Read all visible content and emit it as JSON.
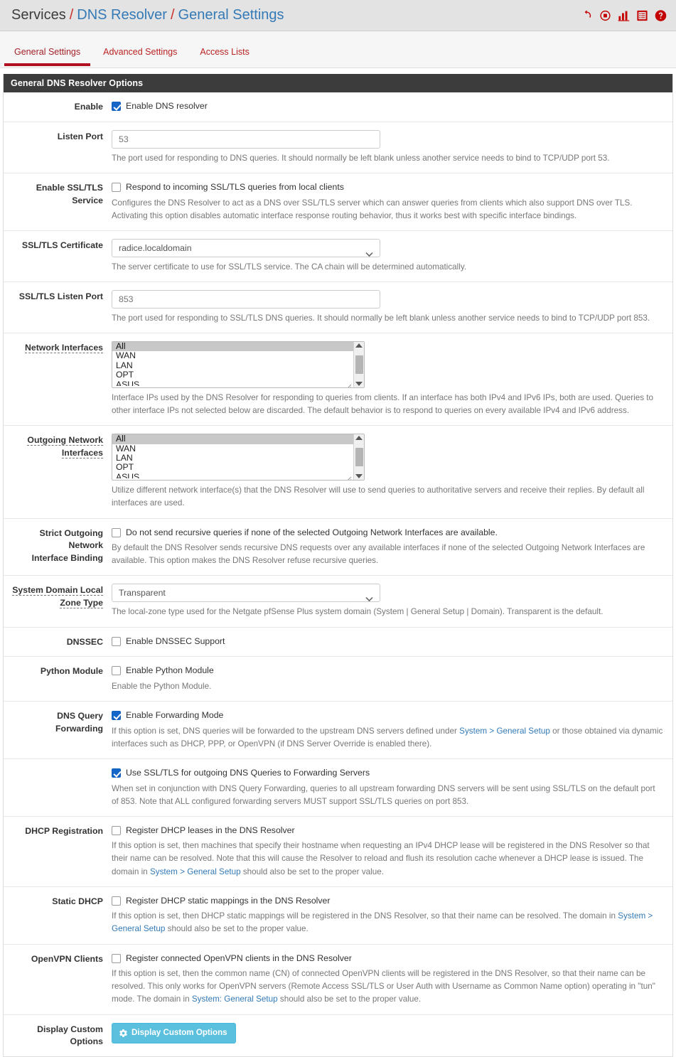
{
  "breadcrumb": {
    "root": "Services",
    "sep": "/",
    "section": "DNS Resolver",
    "page": "General Settings"
  },
  "header_icons": [
    {
      "name": "restart-service-icon",
      "title": "Restart Service"
    },
    {
      "name": "stop-service-icon",
      "title": "Stop Service"
    },
    {
      "name": "status-chart-icon",
      "title": "Status"
    },
    {
      "name": "log-list-icon",
      "title": "Logs"
    },
    {
      "name": "help-icon",
      "title": "Help"
    }
  ],
  "tabs": [
    {
      "label": "General Settings",
      "active": true
    },
    {
      "label": "Advanced Settings",
      "active": false
    },
    {
      "label": "Access Lists",
      "active": false
    }
  ],
  "panel": {
    "title": "General DNS Resolver Options"
  },
  "rows": {
    "enable": {
      "label": "Enable",
      "checkbox_label": "Enable DNS resolver",
      "checked": true
    },
    "listen_port": {
      "label": "Listen Port",
      "placeholder": "53",
      "value": "",
      "help": "The port used for responding to DNS queries. It should normally be left blank unless another service needs to bind to TCP/UDP port 53."
    },
    "ssl_tls_service": {
      "label": "Enable SSL/TLS Service",
      "checkbox_label": "Respond to incoming SSL/TLS queries from local clients",
      "checked": false,
      "help": "Configures the DNS Resolver to act as a DNS over SSL/TLS server which can answer queries from clients which also support DNS over TLS. Activating this option disables automatic interface response routing behavior, thus it works best with specific interface bindings."
    },
    "ssl_tls_certificate": {
      "label": "SSL/TLS Certificate",
      "selected": "radice.localdomain",
      "help": "The server certificate to use for SSL/TLS service. The CA chain will be determined automatically."
    },
    "ssl_tls_listen_port": {
      "label": "SSL/TLS Listen Port",
      "placeholder": "853",
      "value": "",
      "help": "The port used for responding to SSL/TLS DNS queries. It should normally be left blank unless another service needs to bind to TCP/UDP port 853."
    },
    "network_interfaces": {
      "label": "Network Interfaces",
      "options": [
        "All",
        "WAN",
        "LAN",
        "OPT",
        "ASUS"
      ],
      "selected": [
        "All"
      ],
      "help": "Interface IPs used by the DNS Resolver for responding to queries from clients. If an interface has both IPv4 and IPv6 IPs, both are used. Queries to other interface IPs not selected below are discarded. The default behavior is to respond to queries on every available IPv4 and IPv6 address."
    },
    "outgoing_network_interfaces": {
      "label_line1": "Outgoing Network",
      "label_line2": "Interfaces",
      "options": [
        "All",
        "WAN",
        "LAN",
        "OPT",
        "ASUS"
      ],
      "selected": [
        "All"
      ],
      "help": "Utilize different network interface(s) that the DNS Resolver will use to send queries to authoritative servers and receive their replies. By default all interfaces are used."
    },
    "strict_binding": {
      "label_line1": "Strict Outgoing Network",
      "label_line2": "Interface Binding",
      "checkbox_label": "Do not send recursive queries if none of the selected Outgoing Network Interfaces are available.",
      "checked": false,
      "help": "By default the DNS Resolver sends recursive DNS requests over any available interfaces if none of the selected Outgoing Network Interfaces are available. This option makes the DNS Resolver refuse recursive queries."
    },
    "system_domain_local_zone_type": {
      "label_line1": "System Domain Local",
      "label_line2": "Zone Type",
      "selected": "Transparent",
      "help": "The local-zone type used for the Netgate pfSense Plus system domain (System | General Setup | Domain). Transparent is the default."
    },
    "dnssec": {
      "label": "DNSSEC",
      "checkbox_label": "Enable DNSSEC Support",
      "checked": false
    },
    "python_module": {
      "label": "Python Module",
      "checkbox_label": "Enable Python Module",
      "checked": false,
      "help": "Enable the Python Module."
    },
    "dns_query_forwarding": {
      "label": "DNS Query Forwarding",
      "checkbox_label": "Enable Forwarding Mode",
      "checked": true,
      "help_part1": "If this option is set, DNS queries will be forwarded to the upstream DNS servers defined under ",
      "help_link": "System > General Setup",
      "help_part2": " or those obtained via dynamic interfaces such as DHCP, PPP, or OpenVPN (if DNS Server Override is enabled there)."
    },
    "ssl_forwarding": {
      "label": "",
      "checkbox_label": "Use SSL/TLS for outgoing DNS Queries to Forwarding Servers",
      "checked": true,
      "help": "When set in conjunction with DNS Query Forwarding, queries to all upstream forwarding DNS servers will be sent using SSL/TLS on the default port of 853. Note that ALL configured forwarding servers MUST support SSL/TLS queries on port 853."
    },
    "dhcp_registration": {
      "label": "DHCP Registration",
      "checkbox_label": "Register DHCP leases in the DNS Resolver",
      "checked": false,
      "help_part1": "If this option is set, then machines that specify their hostname when requesting an IPv4 DHCP lease will be registered in the DNS Resolver so that their name can be resolved. Note that this will cause the Resolver to reload and flush its resolution cache whenever a DHCP lease is issued. The domain in ",
      "help_link": "System > General Setup",
      "help_part2": " should also be set to the proper value."
    },
    "static_dhcp": {
      "label": "Static DHCP",
      "checkbox_label": "Register DHCP static mappings in the DNS Resolver",
      "checked": false,
      "help_part1": "If this option is set, then DHCP static mappings will be registered in the DNS Resolver, so that their name can be resolved. The domain in ",
      "help_link": "System > General Setup",
      "help_part2": " should also be set to the proper value."
    },
    "openvpn_clients": {
      "label": "OpenVPN Clients",
      "checkbox_label": "Register connected OpenVPN clients in the DNS Resolver",
      "checked": false,
      "help_part1": "If this option is set, then the common name (CN) of connected OpenVPN clients will be registered in the DNS Resolver, so that their name can be resolved. This only works for OpenVPN servers (Remote Access SSL/TLS or User Auth with Username as Common Name option) operating in \"tun\" mode. The domain in ",
      "help_link": "System: General Setup",
      "help_part2": " should also be set to the proper value."
    },
    "display_custom_options": {
      "label": "Display Custom Options",
      "button_label": "Display Custom Options",
      "button_icon": "gear-icon"
    }
  },
  "colors": {
    "accent_red": "#c40000",
    "link_blue": "#337ab7",
    "info_button": "#5bc0de",
    "panel_heading": "#3c3c3c",
    "checkbox_checked": "#1466c8"
  }
}
